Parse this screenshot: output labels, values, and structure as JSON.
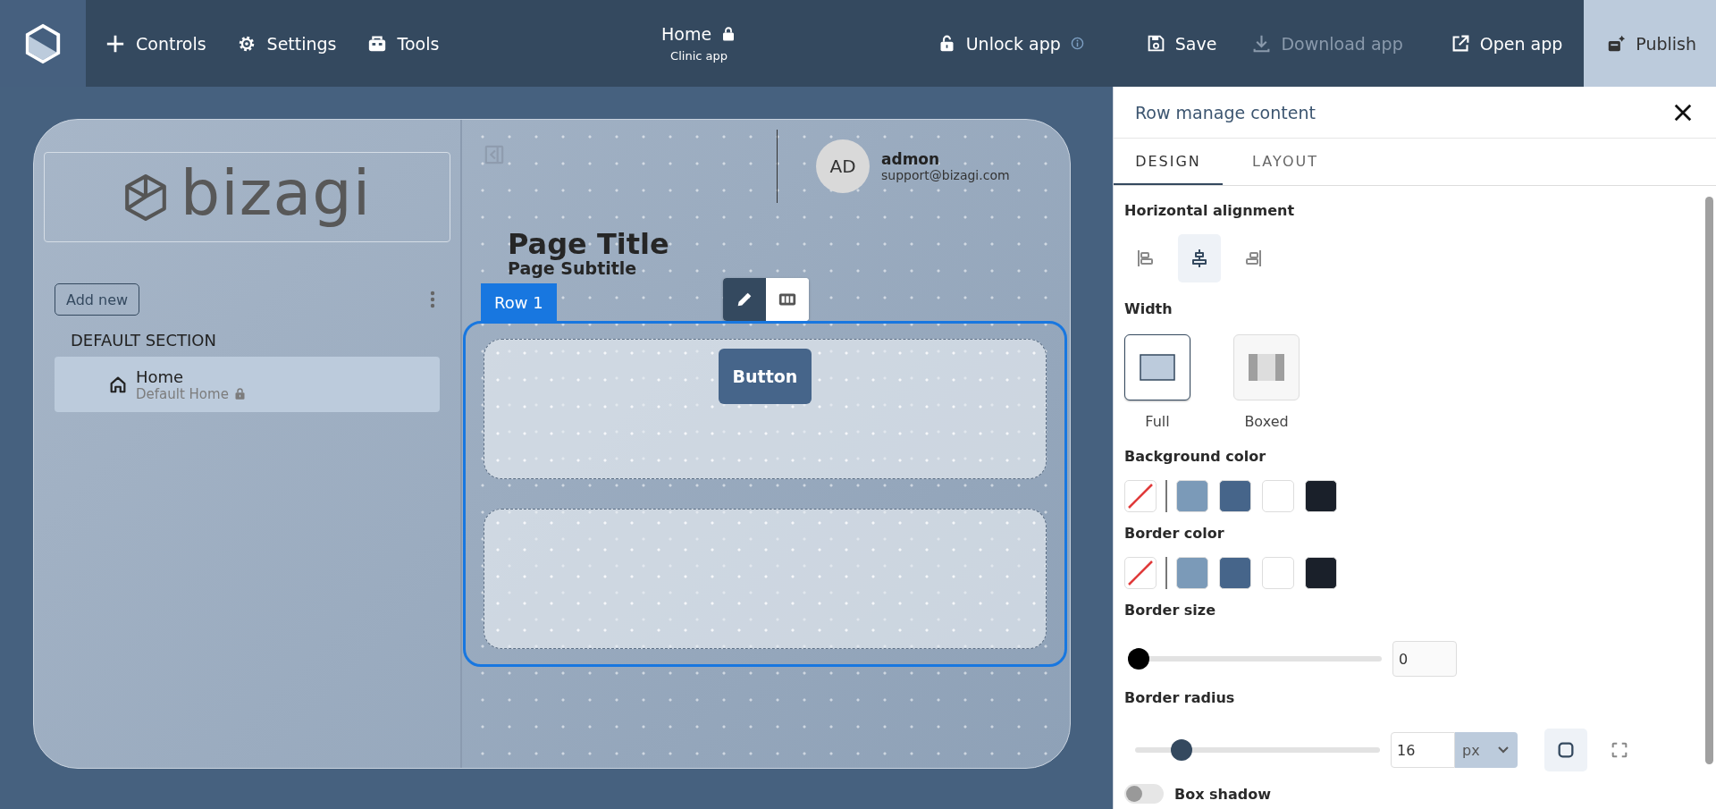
{
  "nav": [
    {
      "label": "Controls"
    },
    {
      "label": "Settings"
    },
    {
      "label": "Tools"
    }
  ],
  "page_header": {
    "title": "Home",
    "locked": true,
    "subtitle": "Clinic app"
  },
  "actions": [
    {
      "label": "Unlock app",
      "info": true,
      "disabled": false,
      "kind": "plain"
    },
    {
      "label": "Save",
      "disabled": false,
      "kind": "plain"
    },
    {
      "label": "Download app",
      "disabled": true,
      "kind": "plain"
    },
    {
      "label": "Open app",
      "disabled": false,
      "kind": "plain"
    },
    {
      "label": "Publish",
      "disabled": false,
      "kind": "primary"
    }
  ],
  "sidebar": {
    "logo_text": "bizagi",
    "add_button": "Add new",
    "sections": [
      {
        "title": "DEFAULT SECTION",
        "pages": [
          {
            "name": "Home",
            "subtitle": "Default Home",
            "locked": true,
            "selected": true
          }
        ]
      }
    ]
  },
  "user": {
    "initials": "AD",
    "name": "admon",
    "email": "support@bizagi.com"
  },
  "page": {
    "title": "Page Title",
    "subtitle": "Page Subtitle"
  },
  "row": {
    "label": "Row 1",
    "selected": true,
    "tools": [
      {
        "selected": true
      },
      {
        "selected": false
      }
    ],
    "columns": [
      {
        "controls": [
          {
            "kind": "button",
            "label": "Button"
          }
        ]
      },
      {}
    ]
  },
  "panel": {
    "title": "Row manage content",
    "tabs": [
      {
        "label": "DESIGN",
        "selected": true
      },
      {
        "label": "LAYOUT",
        "selected": false
      }
    ],
    "horizontal_alignment": {
      "label": "Horizontal alignment",
      "options": [
        {
          "selected": false
        },
        {
          "selected": true
        },
        {
          "selected": false
        }
      ]
    },
    "width": {
      "label": "Width",
      "options": [
        {
          "label": "Full",
          "selected": true
        },
        {
          "label": "Boxed",
          "selected": false
        }
      ]
    },
    "background_color": {
      "label": "Background color",
      "swatches": [
        {
          "kind": "none"
        },
        {
          "kind": "color",
          "color": "#7b9ab8"
        },
        {
          "kind": "color",
          "color": "#46658a"
        },
        {
          "kind": "color",
          "color": "#ffffff"
        },
        {
          "kind": "color",
          "color": "#1a202a"
        }
      ]
    },
    "border_color": {
      "label": "Border color",
      "swatches": [
        {
          "kind": "none"
        },
        {
          "kind": "color",
          "color": "#7b9ab8"
        },
        {
          "kind": "color",
          "color": "#46658a"
        },
        {
          "kind": "color",
          "color": "#ffffff"
        },
        {
          "kind": "color",
          "color": "#1a202a"
        }
      ]
    },
    "border_size": {
      "label": "Border size",
      "level": 0,
      "value": "0"
    },
    "border_radius": {
      "label": "Border radius",
      "level": 0.16,
      "value": "16",
      "unit": "px",
      "modes": [
        {
          "selected": true
        },
        {
          "selected": false
        }
      ]
    },
    "box_shadow": {
      "label": "Box shadow",
      "on": false
    }
  }
}
